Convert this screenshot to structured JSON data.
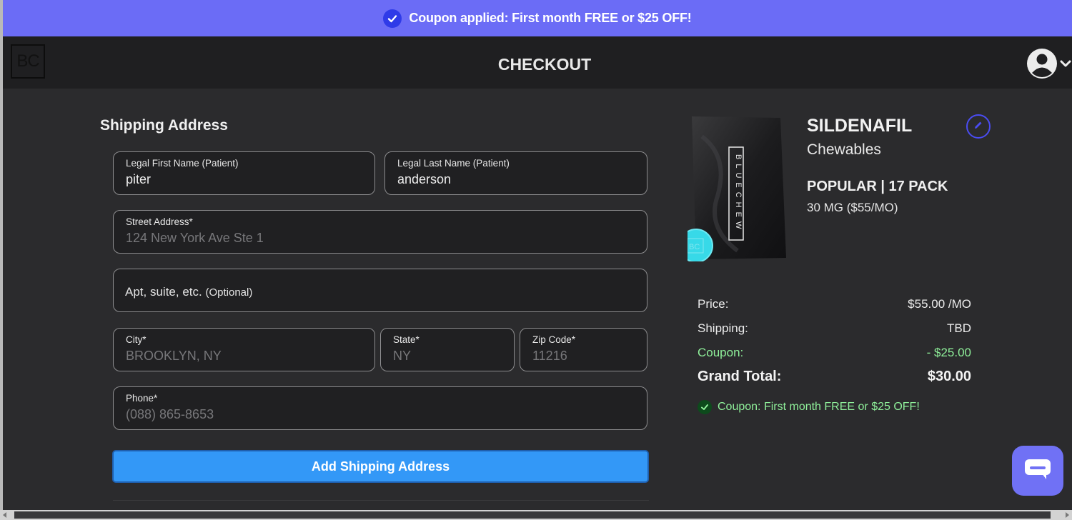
{
  "banner": {
    "text": "Coupon applied: First month FREE or $25 OFF!",
    "bg_color": "#6b6cf6",
    "icon": "check-circle-icon"
  },
  "header": {
    "logo_text": "BC",
    "title": "CHECKOUT",
    "account_icon": "user-circle-icon",
    "dropdown_icon": "chevron-down-icon"
  },
  "shipping": {
    "section_title": "Shipping Address",
    "first_name": {
      "label": "Legal First Name (Patient)",
      "value": "piter"
    },
    "last_name": {
      "label": "Legal Last Name (Patient)",
      "value": "anderson"
    },
    "street": {
      "label": "Street Address*",
      "value": "124 New York Ave Ste 1"
    },
    "apt": {
      "placeholder": "Apt, suite, etc.",
      "placeholder_suffix": "(Optional)"
    },
    "city": {
      "label": "City*",
      "value": "BROOKLYN, NY"
    },
    "state": {
      "label": "State*",
      "value": "NY"
    },
    "zip": {
      "label": "Zip Code*",
      "value": "11216"
    },
    "phone": {
      "label": "Phone*",
      "value": "(088) 865-8653"
    },
    "submit_label": "Add Shipping Address",
    "button_color": "#3398f7"
  },
  "product": {
    "name": "SILDENAFIL",
    "form": "Chewables",
    "pack_size": "POPULAR | 17 PACK",
    "dose": "30 MG ($55/MO)",
    "pack_brand": "BLUECHEW",
    "pill_text": "BC",
    "edit_icon": "pencil-icon"
  },
  "summary": {
    "price_label": "Price:",
    "price_value": "$55.00 /MO",
    "shipping_label": "Shipping:",
    "shipping_value": "TBD",
    "coupon_label": "Coupon:",
    "coupon_value": "- $25.00",
    "total_label": "Grand Total:",
    "total_value": "$30.00",
    "coupon_note": "Coupon: First month FREE or $25 OFF!",
    "coupon_color": "#8ff09a"
  },
  "chat": {
    "icon": "chat-bubble-icon",
    "color": "#7071f5"
  }
}
